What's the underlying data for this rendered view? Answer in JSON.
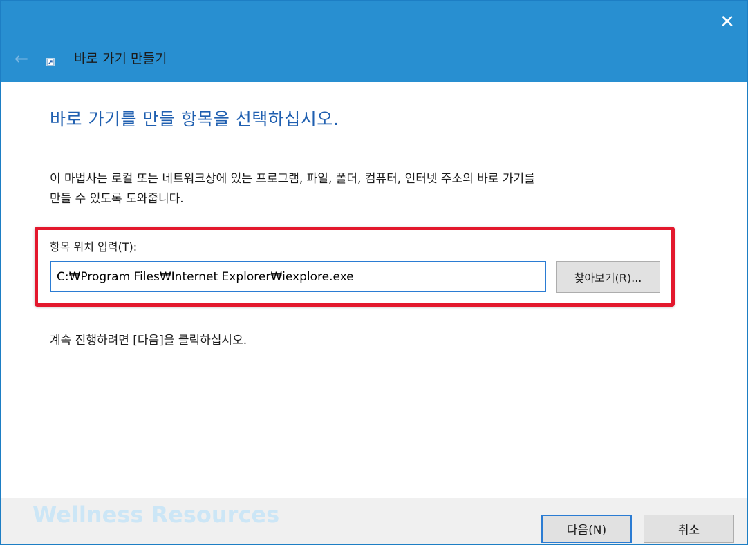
{
  "window": {
    "title": "바로 가기 만들기",
    "close_glyph": "✕",
    "back_glyph": "←",
    "titlebar_color": "#288fd1",
    "icons": {
      "close": "close-icon",
      "back": "arrow-left-icon",
      "wizard": "shortcut-wizard-icon"
    }
  },
  "content": {
    "heading": "바로 가기를 만들 항목을 선택하십시오.",
    "heading_color": "#1f5fb0",
    "description_line1": "이 마법사는 로컬 또는 네트워크상에 있는 프로그램, 파일, 폴더, 컴퓨터, 인터넷 주소의 바로 가기를",
    "description_line2": "만들 수 있도록 도와줍니다.",
    "field_label": "항목 위치 입력(T):",
    "location_value": "C:₩Program Files₩Internet Explorer₩iexplore.exe",
    "browse_label": "찾아보기(R)...",
    "continue_text": "계속 진행하려면 [다음]을 클릭하십시오.",
    "highlight_color": "#e3182d"
  },
  "footer": {
    "watermark": "Wellness Resources",
    "next_label": "다음(N)",
    "cancel_label": "취소"
  }
}
